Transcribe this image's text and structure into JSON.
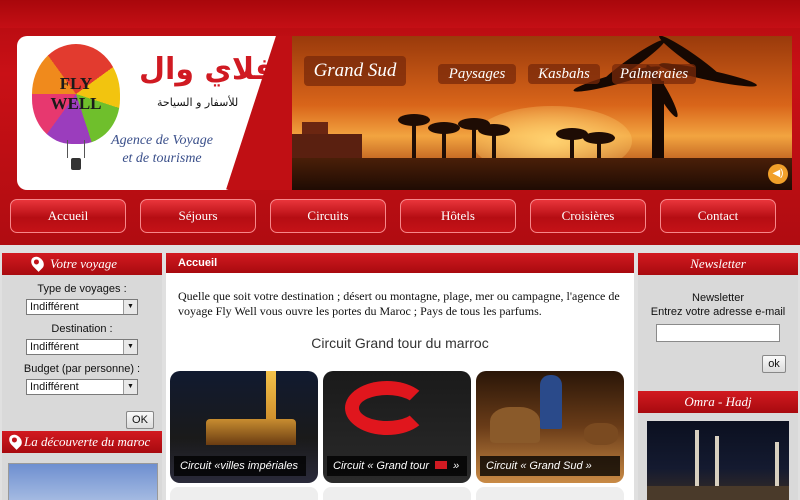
{
  "logo": {
    "balloon_line1": "FLY",
    "balloon_line2": "WELL",
    "arabic_name": "فلاي وال",
    "arabic_tagline": "للأسفار و السياحة",
    "agence_line1": "Agence de Voyage",
    "agence_line2": "et de tourisme"
  },
  "banner": {
    "main_label": "Grand Sud",
    "tags": [
      "Paysages",
      "Kasbahs",
      "Palmeraies"
    ],
    "sound_icon": "speaker-icon"
  },
  "nav": {
    "items": [
      "Accueil",
      "Séjours",
      "Circuits",
      "Hôtels",
      "Croisières",
      "Contact"
    ]
  },
  "left": {
    "header": "Votre voyage",
    "type_label": "Type de voyages :",
    "type_value": "Indifférent",
    "dest_label": "Destination :",
    "dest_value": "Indifférent",
    "budget_label": "Budget (par personne) :",
    "budget_value": "Indifférent",
    "ok_label": "OK",
    "decouverte_header": "La découverte du maroc"
  },
  "main": {
    "header": "Accueil",
    "intro": "Quelle que soit votre destination ; désert ou montagne, plage, mer ou campagne, l'agence de voyage Fly Well vous ouvre les portes du Maroc ; Pays de tous les parfums.",
    "circuit_title": "Circuit Grand tour du marroc",
    "cards": [
      "Circuit «villes impériales »",
      "Circuit « Grand tour",
      "Circuit « Grand Sud »"
    ],
    "card2_suffix": "»"
  },
  "right": {
    "header": "Newsletter",
    "nl_label": "Newsletter",
    "nl_prompt": "Entrez votre adresse e-mail",
    "ok_label": "ok",
    "omra_header": "Omra - Hadj"
  },
  "colors": {
    "brand_red": "#c00f14",
    "accent_orange": "#f1a02a"
  }
}
